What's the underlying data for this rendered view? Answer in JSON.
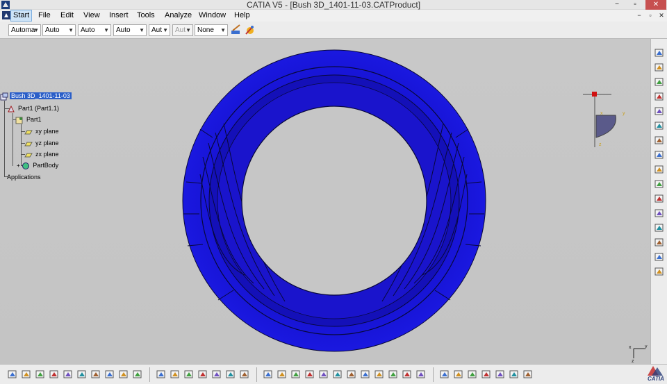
{
  "window": {
    "title": "CATIA V5 - [Bush 3D_1401-11-03.CATProduct]",
    "minimize": "−",
    "restore": "▫",
    "close": "✕",
    "doc_minimize": "−",
    "doc_restore": "▫",
    "doc_close": "✕"
  },
  "menu": {
    "items": [
      "Start",
      "File",
      "Edit",
      "View",
      "Insert",
      "Tools",
      "Analyze",
      "Window",
      "Help"
    ],
    "active": "Start"
  },
  "properties_toolbar": {
    "combos": [
      {
        "value": "Automa",
        "enabled": true
      },
      {
        "value": "Auto",
        "enabled": true
      },
      {
        "value": "Auto",
        "enabled": true
      },
      {
        "value": "Auto",
        "enabled": true
      },
      {
        "value": "Aut",
        "enabled": true
      },
      {
        "value": "Aut",
        "enabled": false
      },
      {
        "value": "None",
        "enabled": true
      }
    ],
    "icons": [
      "format-painter-icon",
      "graphic-properties-icon"
    ]
  },
  "spec_tree": {
    "root": "Bush 3D_1401-11-03",
    "part_instance": "Part1 (Part1.1)",
    "part": "Part1",
    "planes": [
      "xy plane",
      "yz plane",
      "zx plane"
    ],
    "body": "PartBody",
    "applications": "Applications"
  },
  "viewport": {
    "background": "#c6c6c6",
    "part_color": "#1a1adc",
    "part_edge_color": "#0a0a3c",
    "compass_axes": [
      "x",
      "y",
      "z"
    ],
    "axis_triad": [
      "y",
      "x",
      "z"
    ]
  },
  "right_toolbar": {
    "icons": [
      "sketcher-icon",
      "select-icon",
      "part-design-icon",
      "assembly-icon",
      "new-component-icon",
      "existing-component-icon",
      "replace-component-icon",
      "constraint-icon",
      "text-icon",
      "snap-icon",
      "explode-icon",
      "manipulate-icon",
      "clash-icon",
      "scenes-icon",
      "annotation-icon",
      "bill-of-material-icon"
    ]
  },
  "bottom_toolbar": {
    "groups": [
      [
        "new-icon",
        "open-icon",
        "save-icon",
        "print-icon",
        "cut-icon",
        "copy-icon",
        "paste-icon",
        "undo-icon",
        "redo-icon",
        "whats-this-icon"
      ],
      [
        "formula-icon",
        "comment-icon",
        "design-table-icon",
        "catalog-icon",
        "fly-mode-icon",
        "apply-material-icon",
        "measure-icon"
      ],
      [
        "measure-between-icon",
        "fit-all-icon",
        "pan-icon",
        "rotate-icon",
        "zoom-in-icon",
        "zoom-out-icon",
        "normal-view-icon",
        "multi-view-icon",
        "iso-view-icon",
        "view-mode-icon",
        "hide-show-icon",
        "swap-space-icon"
      ],
      [
        "tree-expansion-icon",
        "camera-icon",
        "product-icon",
        "bolt-icon",
        "fastener-icon",
        "update-icon",
        "knowledge-icon"
      ]
    ],
    "logo": "CATIA"
  }
}
